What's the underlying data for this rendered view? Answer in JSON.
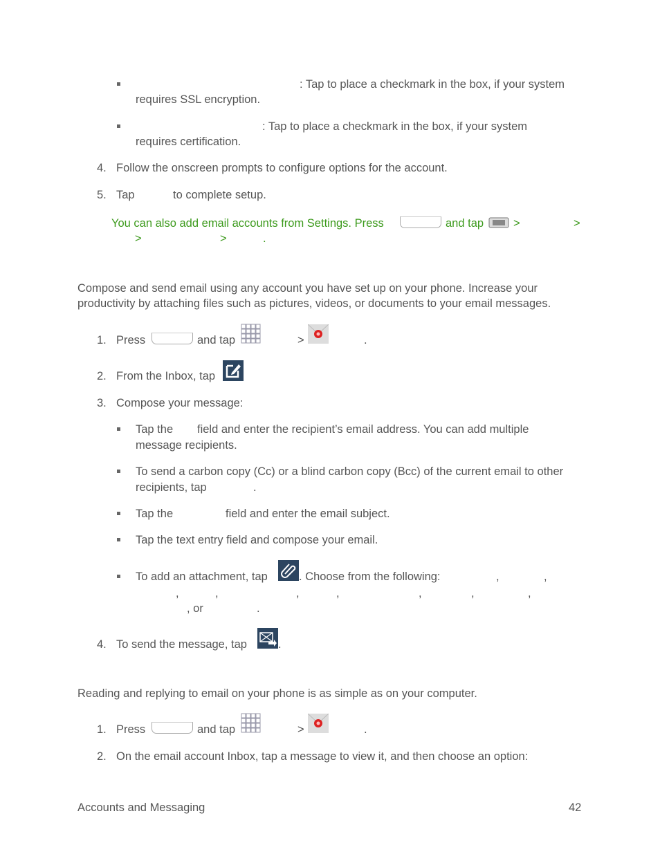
{
  "bullets_top": [
    ": Tap to place a checkmark in the box, if your system",
    "requires SSL encryption.",
    ": Tap to place a checkmark in the box, if your system",
    "requires certification."
  ],
  "steps_a": {
    "n4": "4.",
    "s4": "Follow the onscreen prompts to configure options for the account.",
    "n5": "5.",
    "s5a": "Tap",
    "s5b": "to complete setup."
  },
  "note": {
    "text": "You can also add email accounts from Settings. Press",
    "and_tap": "and tap",
    "gt": ">",
    "dot": "."
  },
  "compose": {
    "intro1": "Compose and send email using any account you have set up on your phone. Increase your",
    "intro2": "productivity by attaching files such as pictures, videos, or documents to your email messages.",
    "n1": "1.",
    "press": "Press",
    "and_tap": "and tap",
    "gt": ">",
    "dot": ".",
    "n2": "2.",
    "s2": "From the Inbox, tap",
    "n3": "3.",
    "s3": "Compose your message:",
    "b1a": "Tap the",
    "b1b": "field and enter the recipient’s email address. You can add multiple",
    "b1c": "message recipients.",
    "b2a": "To send a carbon copy (Cc) or a blind carbon copy (Bcc) of the current email to other",
    "b2b": "recipients, tap",
    "b3a": "Tap the",
    "b3b": "field and enter the email subject.",
    "b4": "Tap the text entry field and compose your email.",
    "b5a": "To add an attachment, tap",
    "b5b": ". Choose from the following:",
    "comma": ",",
    "or": ", or",
    "n4": "4.",
    "s4": "To send the message, tap"
  },
  "read": {
    "intro": "Reading and replying to email on your phone is as simple as on your computer.",
    "n1": "1.",
    "press": "Press",
    "and_tap": "and tap",
    "gt": ">",
    "dot": ".",
    "n2": "2.",
    "s2": "On the email account Inbox, tap a message to view it, and then choose an option:"
  },
  "footer": {
    "section": "Accounts and Messaging",
    "page": "42"
  }
}
